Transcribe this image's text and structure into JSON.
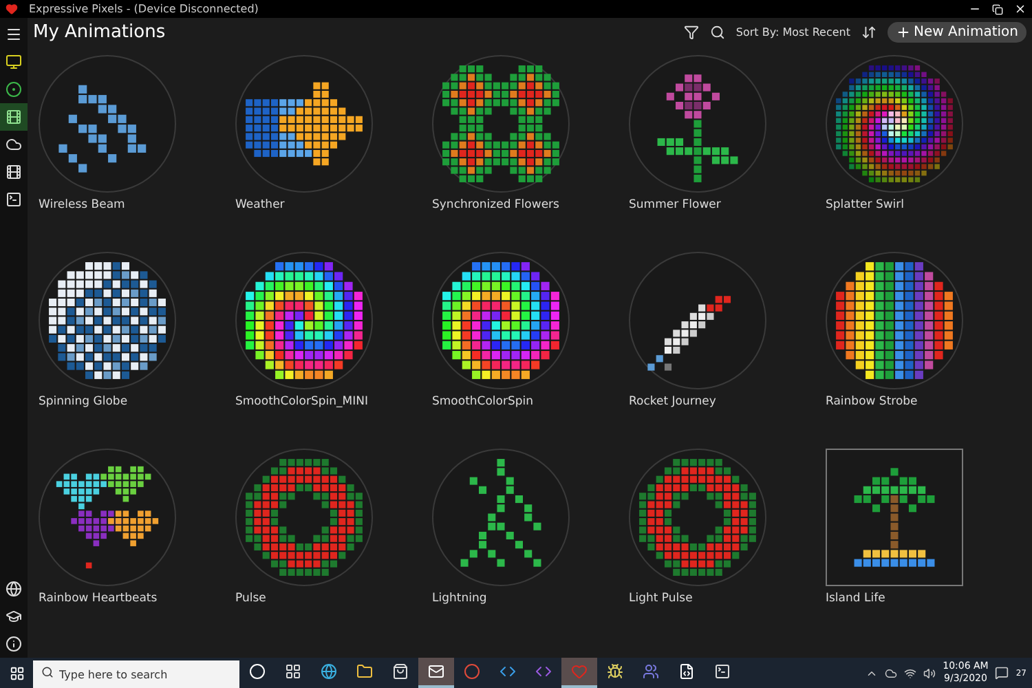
{
  "window": {
    "title": "Expressive Pixels - (Device Disconnected)"
  },
  "sidebar": {
    "items": [
      {
        "kind": "device",
        "selected": false
      },
      {
        "kind": "circle",
        "selected": false
      },
      {
        "kind": "gallery",
        "selected": true
      },
      {
        "kind": "cloud",
        "selected": false
      },
      {
        "kind": "devices",
        "selected": false
      },
      {
        "kind": "terminal",
        "selected": false
      }
    ],
    "bottom": [
      {
        "kind": "globe"
      },
      {
        "kind": "cap"
      },
      {
        "kind": "info"
      }
    ]
  },
  "header": {
    "title": "My Animations",
    "sort": "Sort By: Most Recent",
    "new_button": "New Animation"
  },
  "animations": [
    {
      "name": "Wireless Beam",
      "kind": "wireless",
      "selected": false
    },
    {
      "name": "Weather",
      "kind": "weather",
      "selected": false
    },
    {
      "name": "Synchronized Flowers",
      "kind": "flowers",
      "selected": false
    },
    {
      "name": "Summer Flower",
      "kind": "flower",
      "selected": false
    },
    {
      "name": "Splatter Swirl",
      "kind": "swirl",
      "selected": false
    },
    {
      "name": "Spinning Globe",
      "kind": "globe",
      "selected": false
    },
    {
      "name": "SmoothColorSpin_MINI",
      "kind": "spin",
      "selected": false
    },
    {
      "name": "SmoothColorSpin",
      "kind": "spin",
      "selected": false
    },
    {
      "name": "Rocket Journey",
      "kind": "rocket",
      "selected": false
    },
    {
      "name": "Rainbow Strobe",
      "kind": "rainbow",
      "selected": false
    },
    {
      "name": "Rainbow Heartbeats",
      "kind": "hearts",
      "selected": false
    },
    {
      "name": "Pulse",
      "kind": "ring",
      "selected": false
    },
    {
      "name": "Lightning",
      "kind": "lightning",
      "selected": false
    },
    {
      "name": "Light Pulse",
      "kind": "ring",
      "selected": false
    },
    {
      "name": "Island Life",
      "kind": "island",
      "selected": true
    }
  ],
  "taskbar": {
    "search": {
      "placeholder": "Type here to search"
    },
    "apps": [
      {
        "kind": "cortana",
        "selected": false
      },
      {
        "kind": "taskview",
        "selected": false
      },
      {
        "kind": "browser",
        "selected": false
      },
      {
        "kind": "folder",
        "selected": false
      },
      {
        "kind": "store",
        "selected": false
      },
      {
        "kind": "mail",
        "selected": true
      },
      {
        "kind": "chrome",
        "selected": false
      },
      {
        "kind": "code",
        "selected": false
      },
      {
        "kind": "studio",
        "selected": false
      },
      {
        "kind": "heart",
        "selected": true
      },
      {
        "kind": "bug",
        "selected": false
      },
      {
        "kind": "teams",
        "selected": false
      },
      {
        "kind": "xml",
        "selected": false
      },
      {
        "kind": "console",
        "selected": false
      }
    ],
    "time": "10:06 AM",
    "date": "9/3/2020",
    "badge": "27"
  }
}
